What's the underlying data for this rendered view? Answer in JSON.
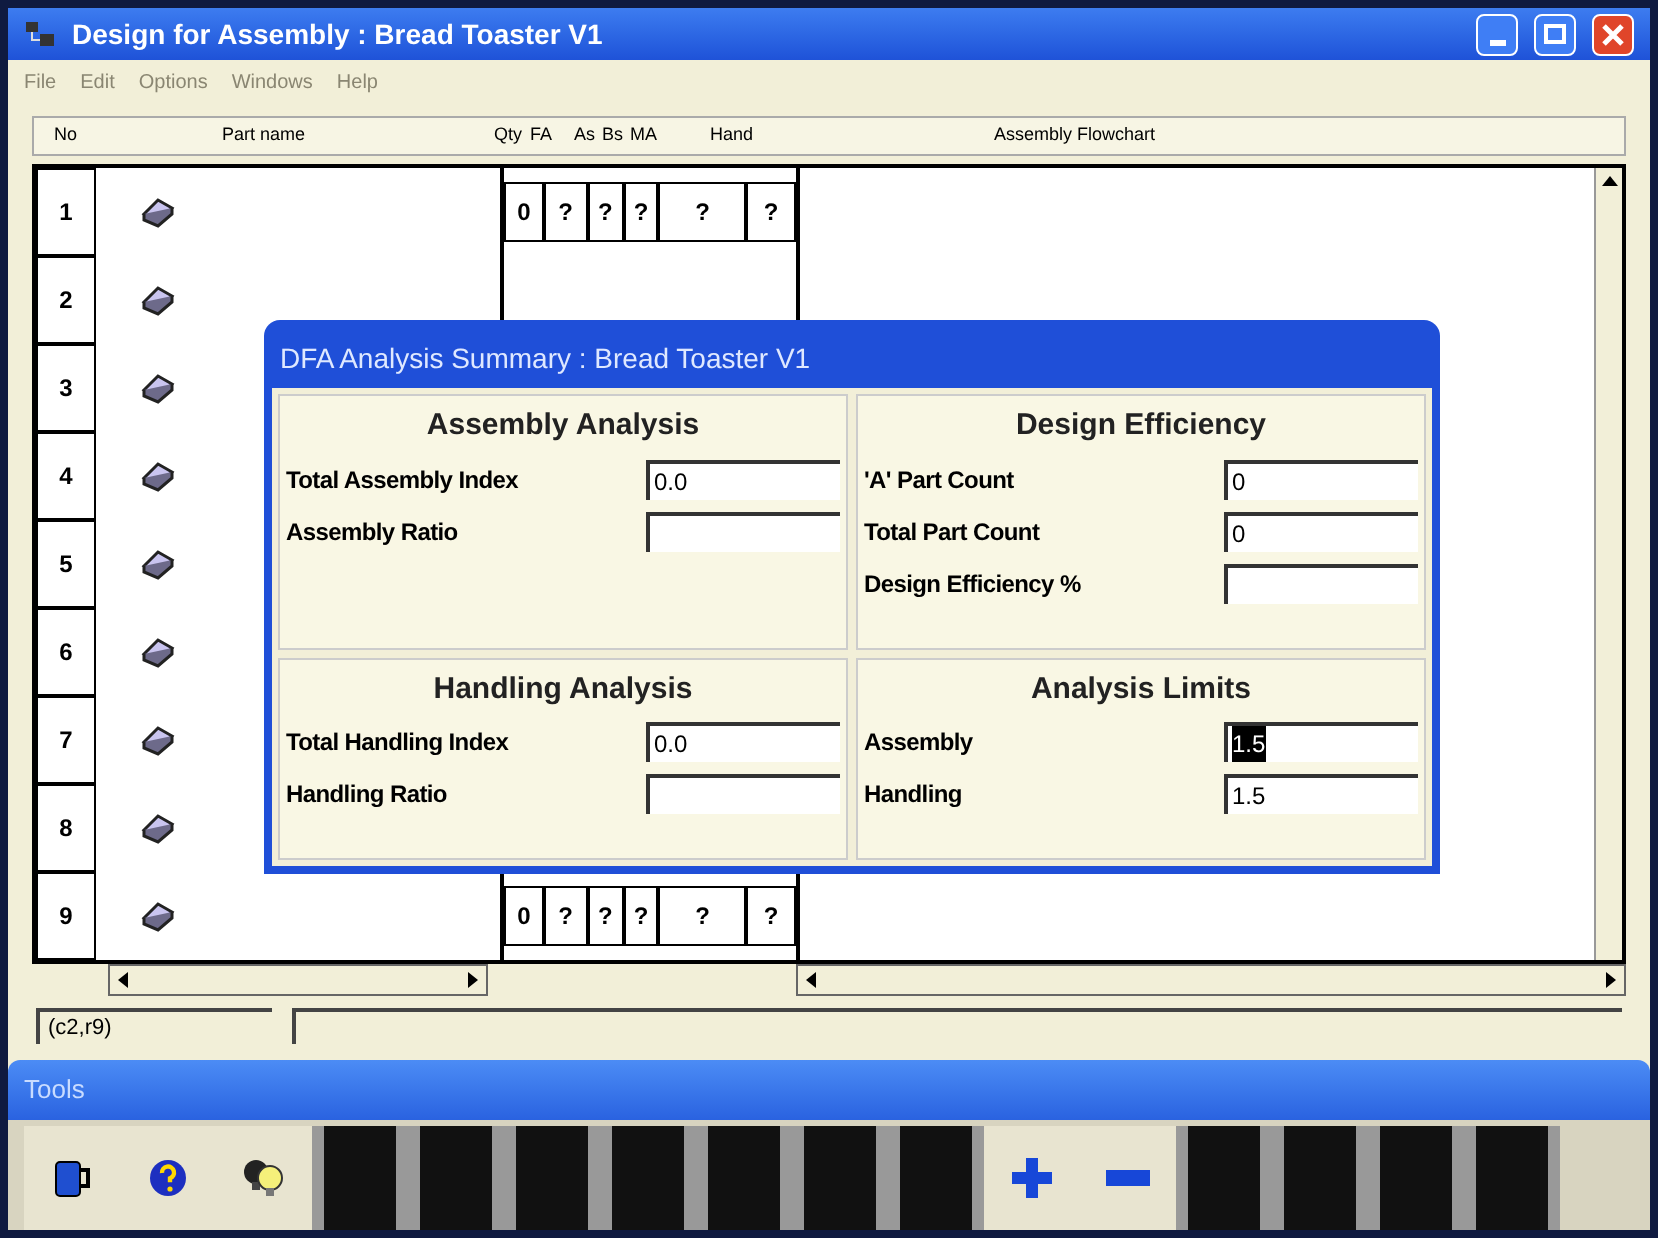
{
  "window": {
    "title": "Design for Assembly : Bread Toaster V1"
  },
  "menu": [
    {
      "label": "File",
      "disabled": true
    },
    {
      "label": "Edit",
      "disabled": true
    },
    {
      "label": "Options",
      "disabled": true
    },
    {
      "label": "Windows",
      "disabled": true
    },
    {
      "label": "Help",
      "disabled": true
    }
  ],
  "columns": [
    "No",
    "Part name",
    "Qty",
    "FA",
    "As",
    "Bs",
    "MA",
    "Hand",
    "Assembly Flowchart"
  ],
  "rows": [
    {
      "no": "1",
      "cells": [
        "0",
        "?",
        "?",
        "?",
        "?",
        "?"
      ]
    },
    {
      "no": "2"
    },
    {
      "no": "3"
    },
    {
      "no": "4"
    },
    {
      "no": "5"
    },
    {
      "no": "6"
    },
    {
      "no": "7"
    },
    {
      "no": "8"
    },
    {
      "no": "9",
      "cells": [
        "0",
        "?",
        "?",
        "?",
        "?",
        "?"
      ]
    }
  ],
  "status": {
    "cell": "(c2,r9)"
  },
  "dialog": {
    "title": "DFA Analysis Summary : Bread Toaster V1",
    "sections": [
      {
        "title": "Assembly Analysis",
        "fields": [
          {
            "label": "Total Assembly Index",
            "value": "0.0"
          },
          {
            "label": "Assembly Ratio"
          }
        ]
      },
      {
        "title": "Design Efficiency",
        "fields": [
          {
            "label": "'A' Part Count",
            "value": "0"
          },
          {
            "label": "Total Part Count",
            "value": "0"
          },
          {
            "label": "Design Efficiency %"
          }
        ]
      },
      {
        "title": "Handling Analysis",
        "fields": [
          {
            "label": "Total Handling Index",
            "value": "0.0"
          },
          {
            "label": "Handling Ratio"
          }
        ]
      },
      {
        "title": "Analysis Limits",
        "fields": [
          {
            "label": "Assembly",
            "value": "1.5",
            "selected": true
          },
          {
            "label": "Handling",
            "value": "1.5",
            "selected": false
          }
        ]
      }
    ]
  },
  "tools": {
    "title": "Tools",
    "buttons": [
      {
        "kind": "mug"
      },
      {
        "kind": "help"
      },
      {
        "kind": "bulbs"
      },
      {
        "kind": "blank"
      },
      {
        "kind": "blank"
      },
      {
        "kind": "blank"
      },
      {
        "kind": "blank"
      },
      {
        "kind": "blank"
      },
      {
        "kind": "blank"
      },
      {
        "kind": "blank"
      },
      {
        "kind": "plus"
      },
      {
        "kind": "minus"
      },
      {
        "kind": "blank"
      },
      {
        "kind": "blank"
      },
      {
        "kind": "blank"
      },
      {
        "kind": "blank"
      }
    ]
  }
}
